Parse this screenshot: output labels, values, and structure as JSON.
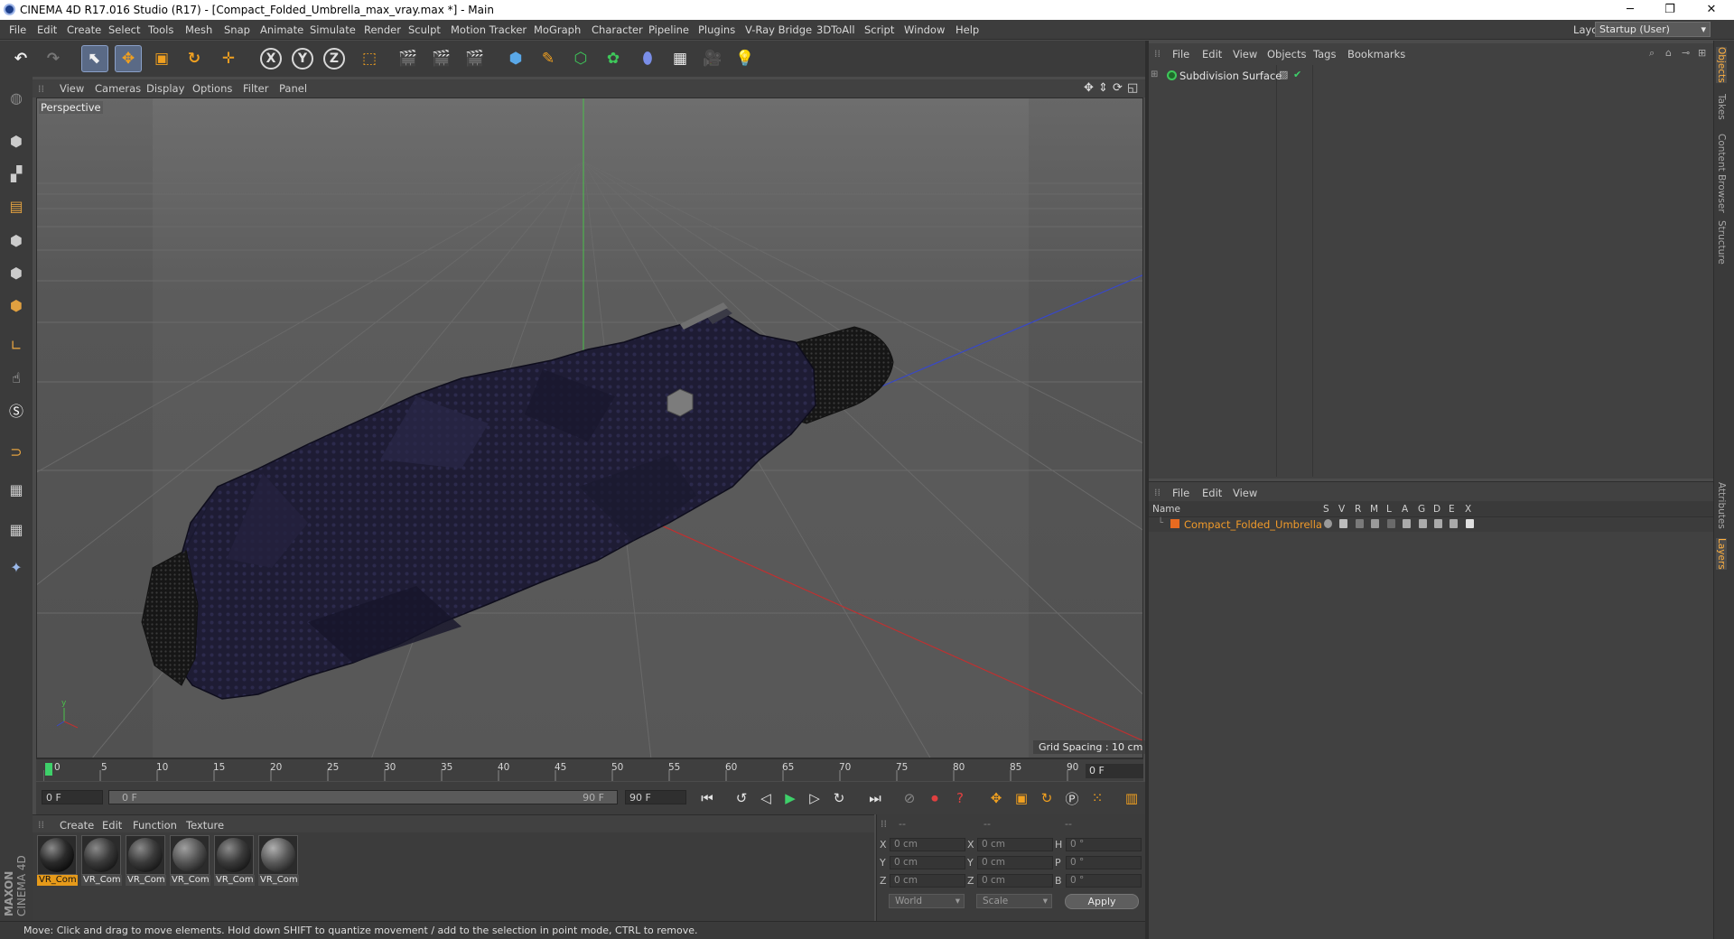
{
  "window": {
    "title": "CINEMA 4D R17.016 Studio (R17) - [Compact_Folded_Umbrella_max_vray.max *] - Main",
    "minimize": "─",
    "restore": "❐",
    "close": "✕"
  },
  "menubar": {
    "items": [
      "File",
      "Edit",
      "Create",
      "Select",
      "Tools",
      "Mesh",
      "Snap",
      "Animate",
      "Simulate",
      "Render",
      "Sculpt",
      "Motion Tracker",
      "MoGraph",
      "Character",
      "Pipeline",
      "Plugins",
      "V-Ray Bridge",
      "3DToAll",
      "Script",
      "Window",
      "Help"
    ],
    "layout_label": "Layout:",
    "layout_value": "Startup (User)"
  },
  "toolbar": {
    "axis_x": "X",
    "axis_y": "Y",
    "axis_z": "Z"
  },
  "viewport": {
    "menu": [
      "View",
      "Cameras",
      "Display",
      "Options",
      "Filter",
      "Panel"
    ],
    "label": "Perspective",
    "grid_spacing": "Grid Spacing : 10 cm"
  },
  "timeline": {
    "ticks": [
      "0",
      "5",
      "10",
      "15",
      "20",
      "25",
      "30",
      "35",
      "40",
      "45",
      "50",
      "55",
      "60",
      "65",
      "70",
      "75",
      "80",
      "85",
      "90"
    ],
    "current_frame": "0 F",
    "start_field": "0 F",
    "range_start": "0 F",
    "range_end": "90 F",
    "end_field": "90 F"
  },
  "materials": {
    "menu": [
      "Create",
      "Edit",
      "Function",
      "Texture"
    ],
    "items": [
      "VR_Com",
      "VR_Com",
      "VR_Com",
      "VR_Com",
      "VR_Com",
      "VR_Com"
    ]
  },
  "coordinates": {
    "head": [
      "--",
      "--",
      "--"
    ],
    "rows": [
      {
        "a": "X",
        "av": "0 cm",
        "b": "X",
        "bv": "0 cm",
        "c": "H",
        "cv": "0 °"
      },
      {
        "a": "Y",
        "av": "0 cm",
        "b": "Y",
        "bv": "0 cm",
        "c": "P",
        "cv": "0 °"
      },
      {
        "a": "Z",
        "av": "0 cm",
        "b": "Z",
        "bv": "0 cm",
        "c": "B",
        "cv": "0 °"
      }
    ],
    "mode": "World",
    "size": "Scale",
    "apply": "Apply"
  },
  "status": {
    "text": "Move: Click and drag to move elements. Hold down SHIFT to quantize movement / add to the selection in point mode, CTRL to remove.",
    "logo_line1": "MAXON",
    "logo_line2": "CINEMA 4D"
  },
  "objects": {
    "menu": [
      "File",
      "Edit",
      "View",
      "Objects",
      "Tags",
      "Bookmarks"
    ],
    "item": "Subdivision Surface"
  },
  "layers": {
    "menu": [
      "File",
      "Edit",
      "View"
    ],
    "columns": [
      "Name",
      "S",
      "V",
      "R",
      "M",
      "L",
      "A",
      "G",
      "D",
      "E",
      "X"
    ],
    "item": "Compact_Folded_Umbrella"
  },
  "side_tabs": [
    "Objects",
    "Takes",
    "Content Browser",
    "Structure",
    "Attributes",
    "Layers"
  ]
}
